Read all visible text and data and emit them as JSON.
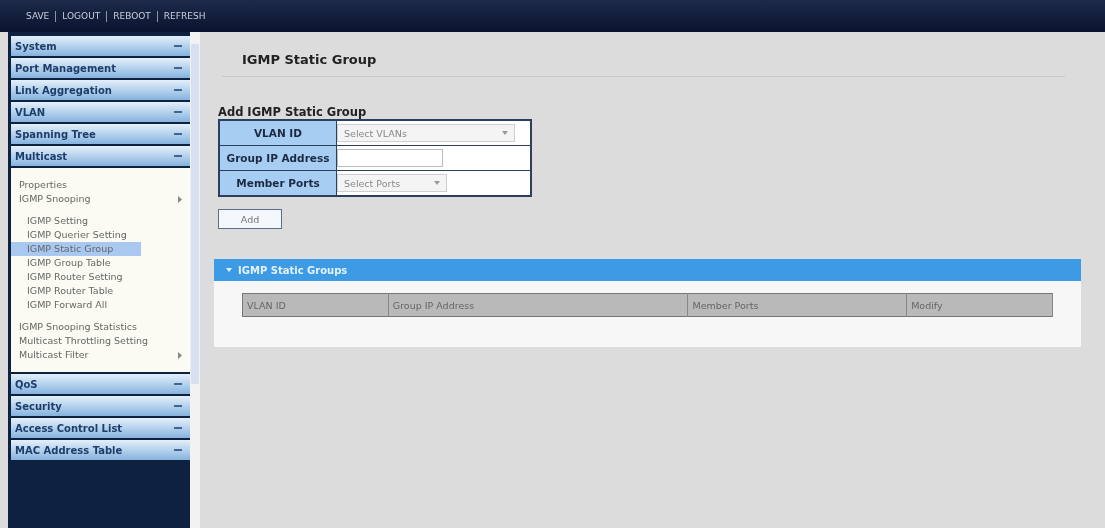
{
  "top_links": [
    "SAVE",
    "LOGOUT",
    "REBOOT",
    "REFRESH"
  ],
  "sidebar": {
    "sections": [
      {
        "label": "System"
      },
      {
        "label": "Port Management"
      },
      {
        "label": "Link Aggregation"
      },
      {
        "label": "VLAN"
      },
      {
        "label": "Spanning Tree"
      },
      {
        "label": "Multicast",
        "items": [
          {
            "label": "Properties",
            "kind": "page",
            "selected": false
          },
          {
            "label": "IGMP Snooping",
            "kind": "folder",
            "selected": false,
            "children": [
              {
                "label": "IGMP Setting",
                "selected": false
              },
              {
                "label": "IGMP Querier Setting",
                "selected": false
              },
              {
                "label": "IGMP Static Group",
                "selected": true
              },
              {
                "label": "IGMP Group Table",
                "selected": false
              },
              {
                "label": "IGMP Router Setting",
                "selected": false
              },
              {
                "label": "IGMP Router Table",
                "selected": false
              },
              {
                "label": "IGMP Forward All",
                "selected": false
              }
            ]
          },
          {
            "label": "IGMP Snooping Statistics",
            "kind": "page",
            "selected": false
          },
          {
            "label": "Multicast Throttling Setting",
            "kind": "page",
            "selected": false
          },
          {
            "label": "Multicast Filter",
            "kind": "folder",
            "selected": false
          }
        ]
      },
      {
        "label": "QoS"
      },
      {
        "label": "Security"
      },
      {
        "label": "Access Control List"
      },
      {
        "label": "MAC Address Table"
      }
    ]
  },
  "page_title": "IGMP Static Group",
  "form": {
    "title": "Add IGMP Static Group",
    "fields": [
      {
        "label": "VLAN ID",
        "kind": "select",
        "placeholder": "Select VLANs",
        "wide": true
      },
      {
        "label": "Group IP Address",
        "kind": "text"
      },
      {
        "label": "Member Ports",
        "kind": "select",
        "placeholder": "Select Ports",
        "wide": false
      }
    ],
    "button": "Add"
  },
  "groups_panel": {
    "title": "IGMP Static Groups",
    "expanded": true,
    "columns": [
      "VLAN ID",
      "Group IP Address",
      "Member Ports",
      "Modify"
    ]
  }
}
